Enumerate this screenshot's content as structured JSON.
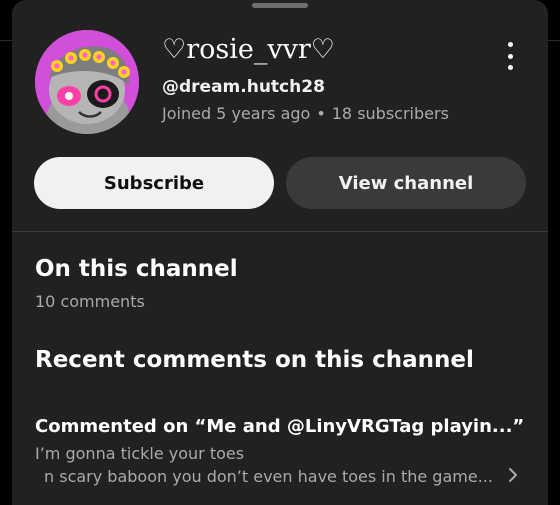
{
  "channel": {
    "name": "♡rosie_vvr♡",
    "handle": "@dream.hutch28",
    "joined": "Joined 5 years ago",
    "separator": "•",
    "subscribers": "18 subscribers"
  },
  "actions": {
    "subscribe_label": "Subscribe",
    "view_channel_label": "View channel"
  },
  "on_channel": {
    "title": "On this channel",
    "count": "10 comments"
  },
  "recent": {
    "title": "Recent comments on this channel",
    "comment": {
      "commented_on": "Commented on “Me and @LinyVRGTag playin...”",
      "line1": "I’m gonna tickle your toes",
      "line2": "n scary baboon you don’t even have toes in the game..."
    }
  },
  "icons": {
    "more": "more-vert-icon",
    "chevron": "chevron-right-icon"
  },
  "colors": {
    "sheet_bg": "#212121",
    "subscribe_bg": "#f1f1f1",
    "view_channel_bg": "#3a3a3a",
    "secondary_text": "#aaaaaa"
  }
}
